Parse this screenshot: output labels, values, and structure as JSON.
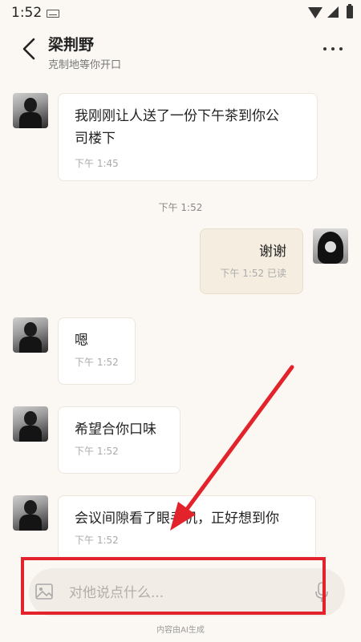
{
  "status": {
    "time": "1:52"
  },
  "header": {
    "name": "梁荆野",
    "subtitle": "克制地等你开口"
  },
  "messages": [
    {
      "text_line1": "我刚刚让人送了一份下午茶到你公",
      "text_line2": "司楼下",
      "time": "下午 1:45"
    },
    {
      "divider": "下午 1:52"
    },
    {
      "text": "谢谢",
      "time": "下午 1:52 已读"
    },
    {
      "text": "嗯",
      "time": "下午 1:52"
    },
    {
      "text": "希望合你口味",
      "time": "下午 1:52"
    },
    {
      "text": "会议间隙看了眼手机，正好想到你",
      "time": "下午 1:52"
    }
  ],
  "input": {
    "placeholder": "对他说点什么..."
  },
  "footer": {
    "note": "内容由AI生成"
  },
  "colors": {
    "accent_red": "#e3232b",
    "bubble_out": "#f6ede1",
    "background": "#fbf8f3"
  }
}
